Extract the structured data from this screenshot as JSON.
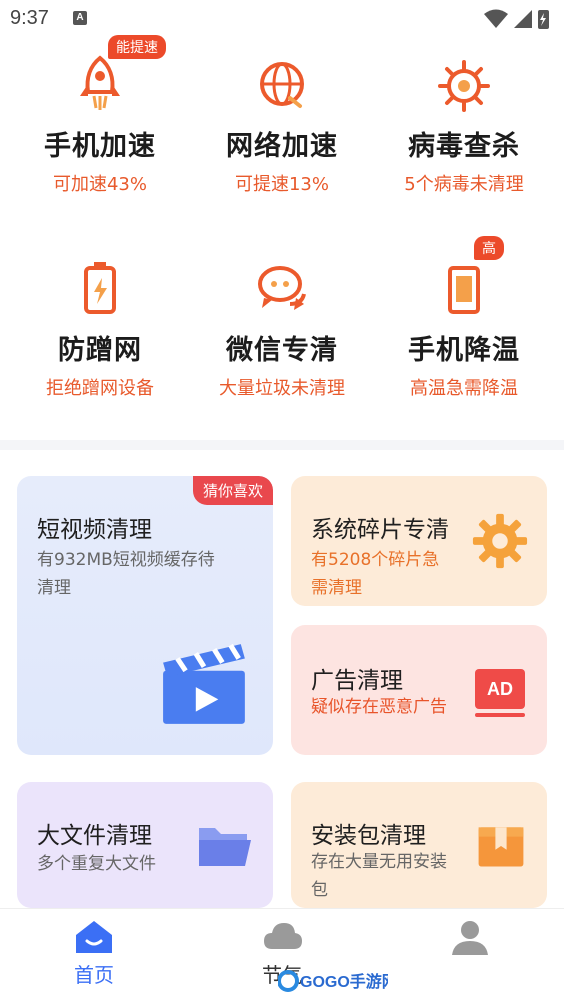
{
  "status_bar": {
    "time": "9:37",
    "notif": "A"
  },
  "tools": [
    {
      "title": "手机加速",
      "sub": "可加速43%",
      "icon": "rocket-icon",
      "tag": "能提速"
    },
    {
      "title": "网络加速",
      "sub": "可提速13%",
      "icon": "globe-icon"
    },
    {
      "title": "病毒查杀",
      "sub": "5个病毒未清理",
      "icon": "virus-icon"
    },
    {
      "title": "防蹭网",
      "sub": "拒绝蹭网设备",
      "icon": "battery-icon"
    },
    {
      "title": "微信专清",
      "sub": "大量垃圾未清理",
      "icon": "chat-icon"
    },
    {
      "title": "手机降温",
      "sub": "高温急需降温",
      "icon": "phone-cool-icon",
      "tag": "高"
    }
  ],
  "cards": {
    "short_video": {
      "title": "短视频清理",
      "sub_line1": "有932MB短视频缓存待",
      "sub_line2": "清理",
      "badge": "猜你喜欢",
      "icon": "clapperboard-icon"
    },
    "fragments": {
      "title": "系统碎片专清",
      "sub_line1": "有5208个碎片急",
      "sub_line2": "需清理",
      "icon": "gear-icon"
    },
    "ads": {
      "title": "广告清理",
      "sub": "疑似存在恶意广告",
      "icon_text": "AD",
      "icon": "ad-icon"
    },
    "big_files": {
      "title": "大文件清理",
      "sub": "多个重复大文件",
      "icon": "folder-icon"
    },
    "apk": {
      "title": "安装包清理",
      "sub_line1": "存在大量无用安装",
      "sub_line2": "包",
      "icon": "package-icon"
    }
  },
  "nav": [
    {
      "label": "首页",
      "icon": "home-icon",
      "active": true
    },
    {
      "label": "节气",
      "icon": "cloud-icon",
      "active": false
    },
    {
      "label": "",
      "icon": "profile-icon",
      "active": false
    }
  ],
  "watermark": "GOGO手游网",
  "colors": {
    "accent": "#e85a2c",
    "tag": "#ec4a2a",
    "nav_active": "#3b6ff5"
  }
}
